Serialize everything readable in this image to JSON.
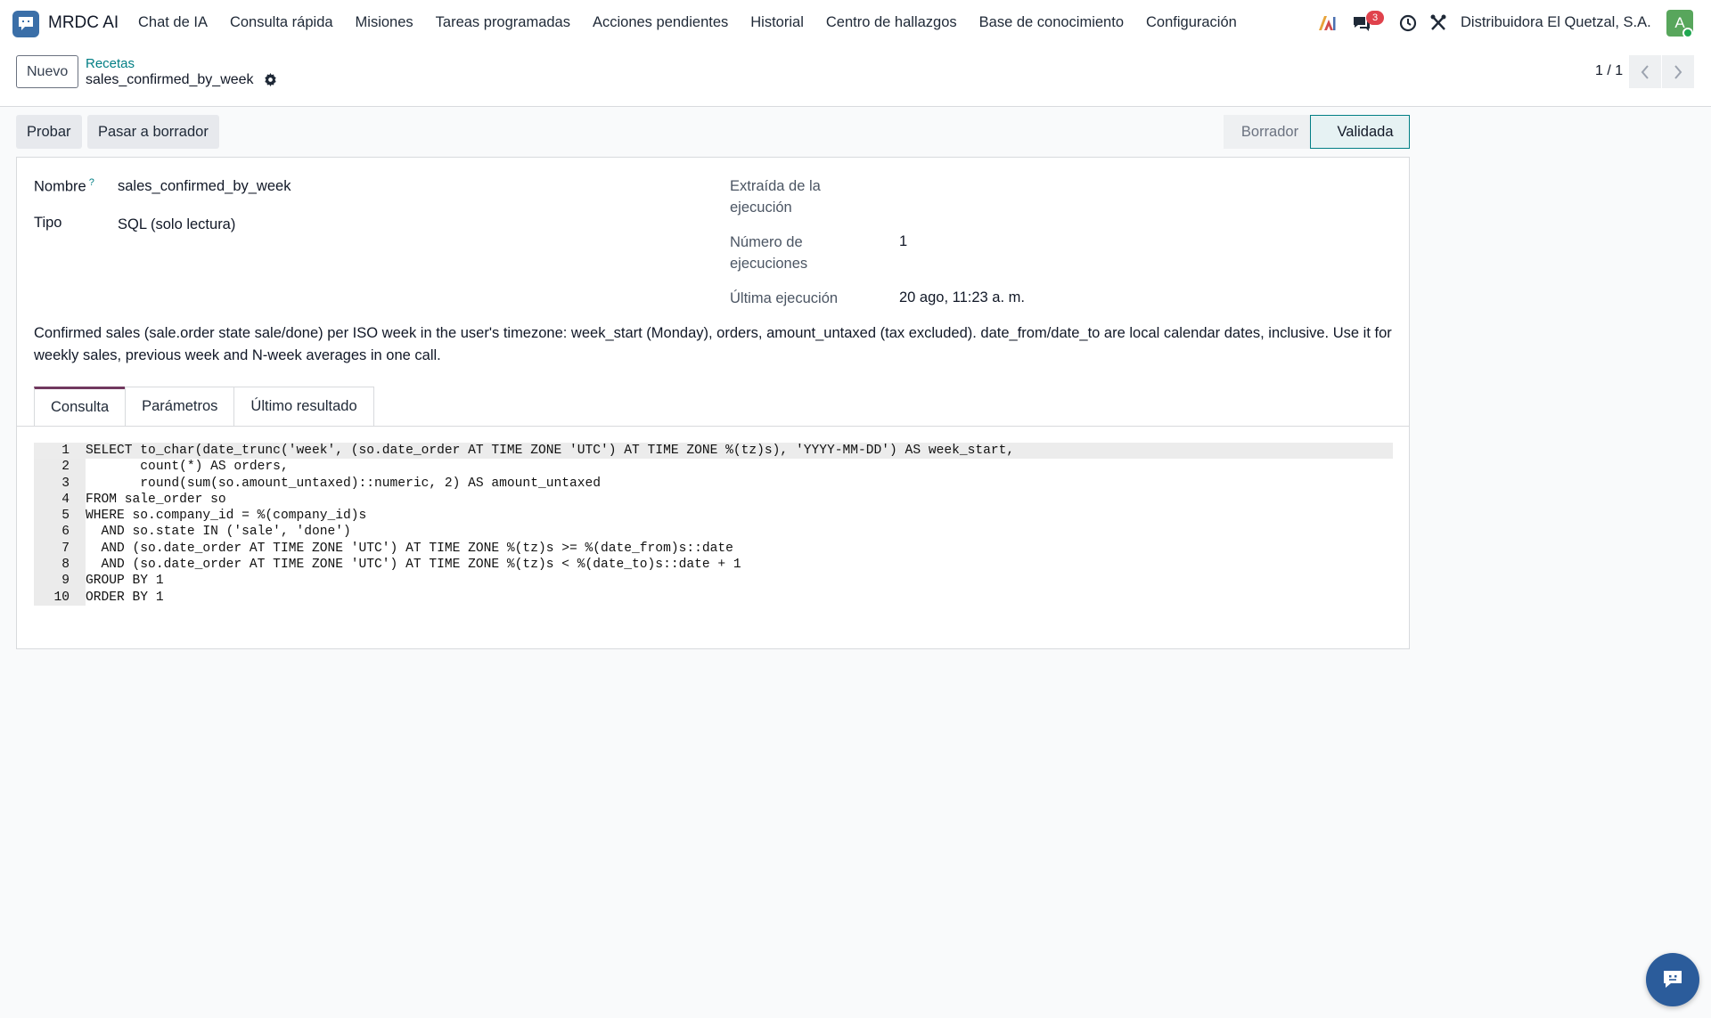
{
  "app": {
    "name": "MRDC AI"
  },
  "menu": [
    "Chat de IA",
    "Consulta rápida",
    "Misiones",
    "Tareas programadas",
    "Acciones pendientes",
    "Historial",
    "Centro de hallazgos",
    "Base de conocimiento",
    "Configuración"
  ],
  "systray": {
    "messages_count": "3",
    "company": "Distribuidora El Quetzal, S.A.",
    "avatar_letter": "A"
  },
  "control": {
    "new_label": "Nuevo",
    "breadcrumb_parent": "Recetas",
    "breadcrumb_current": "sales_confirmed_by_week",
    "pager": "1 / 1"
  },
  "actions": {
    "test_label": "Probar",
    "to_draft_label": "Pasar a borrador"
  },
  "status": {
    "stages": [
      "Borrador",
      "Validada"
    ],
    "current": "Validada"
  },
  "form": {
    "name_label": "Nombre",
    "help_mark": "?",
    "name_value": "sales_confirmed_by_week",
    "type_label": "Tipo",
    "type_value": "SQL (solo lectura)",
    "extracted_label": "Extraída de la ejecución",
    "runs_label": "Número de ejecuciones",
    "runs_value": "1",
    "last_run_label": "Última ejecución",
    "last_run_value": "20 ago, 11:23 a. m.",
    "description": "Confirmed sales (sale.order state sale/done) per ISO week in the user's timezone: week_start (Monday), orders, amount_untaxed (tax excluded). date_from/date_to are local calendar dates, inclusive. Use it for weekly sales, previous week and N-week averages in one call."
  },
  "tabs": [
    "Consulta",
    "Parámetros",
    "Último resultado"
  ],
  "code": {
    "lines": [
      {
        "num": "1",
        "text": "SELECT to_char(date_trunc('week', (so.date_order AT TIME ZONE 'UTC') AT TIME ZONE %(tz)s), 'YYYY-MM-DD') AS week_start,"
      },
      {
        "num": "2",
        "text": "       count(*) AS orders,"
      },
      {
        "num": "3",
        "text": "       round(sum(so.amount_untaxed)::numeric, 2) AS amount_untaxed"
      },
      {
        "num": "4",
        "text": "FROM sale_order so"
      },
      {
        "num": "5",
        "text": "WHERE so.company_id = %(company_id)s"
      },
      {
        "num": "6",
        "text": "  AND so.state IN ('sale', 'done')"
      },
      {
        "num": "7",
        "text": "  AND (so.date_order AT TIME ZONE 'UTC') AT TIME ZONE %(tz)s >= %(date_from)s::date"
      },
      {
        "num": "8",
        "text": "  AND (so.date_order AT TIME ZONE 'UTC') AT TIME ZONE %(tz)s < %(date_to)s::date + 1"
      },
      {
        "num": "9",
        "text": "GROUP BY 1"
      },
      {
        "num": "10",
        "text": "ORDER BY 1"
      }
    ]
  },
  "colors": {
    "accent": "#017e84",
    "tab_active": "#71395f",
    "logo": "#3b6fa8"
  }
}
